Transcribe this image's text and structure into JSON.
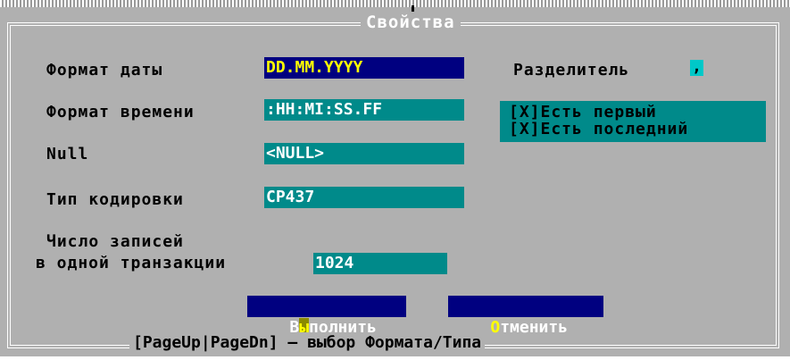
{
  "dialog": {
    "title": "Свойства",
    "bottom_hint": "[PageUp|PageDn] – выбор Формата/Типа"
  },
  "fields": {
    "date_format_label": "Формат даты",
    "date_format_value": "DD.MM.YYYY",
    "time_format_label": "Формат времени",
    "time_format_value": ":HH:MI:SS.FF",
    "null_label": "Null",
    "null_value": "<NULL>",
    "encoding_label": "Тип кодировки",
    "encoding_value": "CP437",
    "records_label_line1": "Число записей",
    "records_label_line2": "в одной транзакции",
    "records_value": "1024"
  },
  "separator": {
    "label": "Разделитель",
    "value": ","
  },
  "checkboxes": [
    {
      "label": "[X]Есть первый"
    },
    {
      "label": "[X]Есть последний"
    }
  ],
  "buttons": {
    "execute_hotkey": "ы",
    "execute_prefix": "В",
    "execute_rest": "полнить",
    "cancel_hotkey": "О",
    "cancel_rest": "тменить"
  },
  "colors": {
    "dialog_bg": "#b0b0b0",
    "field_bg": "#008a8a",
    "button_bg": "#000080",
    "highlight_text": "#ffff00"
  }
}
